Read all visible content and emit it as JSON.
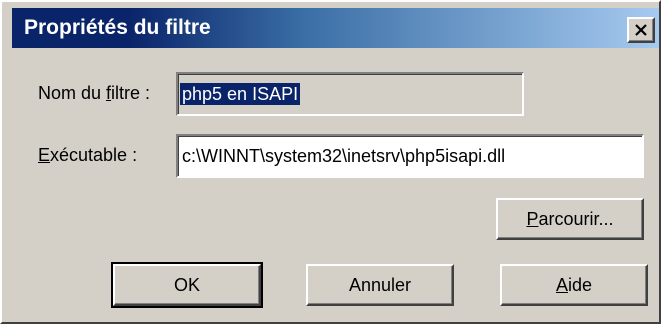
{
  "window": {
    "title": "Propriétés du filtre",
    "close_icon": "close-icon"
  },
  "form": {
    "name_label_pre": "Nom du ",
    "name_label_accel": "f",
    "name_label_post": "iltre :",
    "name_value": "php5 en ISAPI",
    "exe_label_accel": "E",
    "exe_label_post": "xécutable :",
    "exe_value": "c:\\WINNT\\system32\\inetsrv\\php5isapi.dll"
  },
  "buttons": {
    "browse_accel": "P",
    "browse_post": "arcourir...",
    "ok_label": "OK",
    "cancel_label": "Annuler",
    "help_accel": "A",
    "help_post": "ide"
  },
  "colors": {
    "title_start": "#0a246a",
    "title_end": "#a6caf0",
    "face": "#d4d0c8",
    "selection": "#0a246a"
  }
}
